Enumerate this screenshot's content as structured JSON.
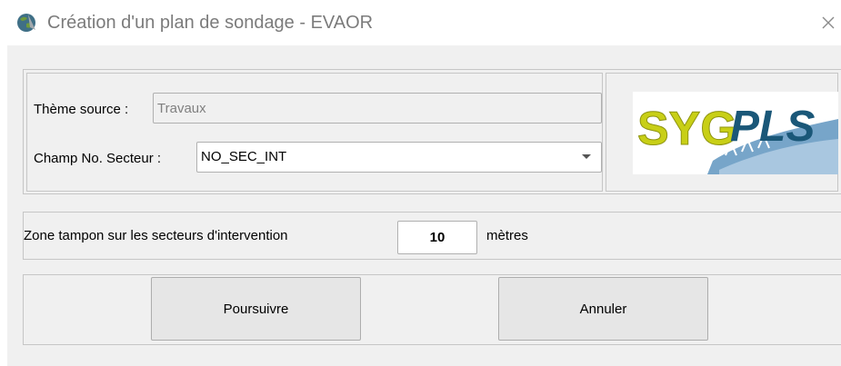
{
  "window": {
    "title": "Création d'un plan de sondage - EVAOR",
    "app_icon": "globe-icon",
    "close_icon": "close-icon"
  },
  "source": {
    "theme_label": "Thème source :",
    "theme_value": "Travaux",
    "champ_label": "Champ No. Secteur :",
    "champ_value": "NO_SEC_INT"
  },
  "logo": {
    "text_a": "SYG",
    "text_b": "PLS"
  },
  "buffer": {
    "label": "Zone tampon sur les secteurs d'intervention",
    "value": "10",
    "unit": "mètres"
  },
  "buttons": {
    "continue_label": "Poursuivre",
    "cancel_label": "Annuler"
  },
  "colors": {
    "logo_yellow": "#c8cf16",
    "logo_blue": "#1a5778",
    "wave": "#5f95bf"
  }
}
